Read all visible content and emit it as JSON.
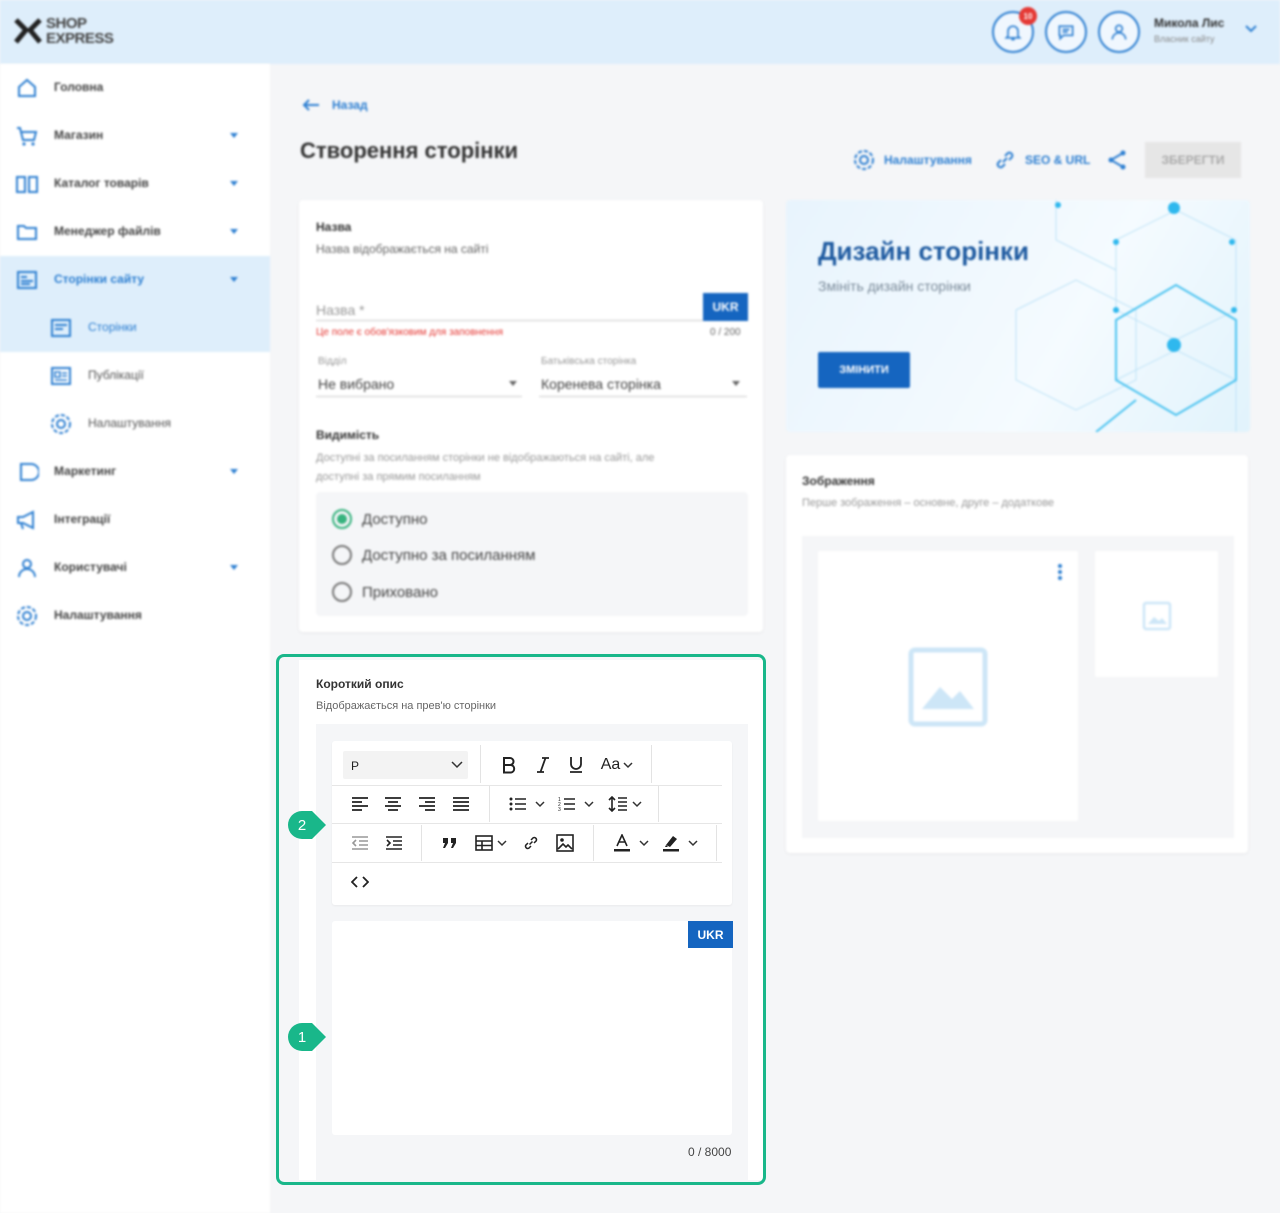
{
  "header": {
    "logo_line1": "SHOP",
    "logo_line2": "EXPRESS",
    "notif_count": "10",
    "user_name": "Микола Лис",
    "user_role": "Власник сайту"
  },
  "sidebar": {
    "items": [
      {
        "label": "Головна"
      },
      {
        "label": "Магазин"
      },
      {
        "label": "Каталог товарів"
      },
      {
        "label": "Менеджер файлів"
      },
      {
        "label": "Сторінки сайту"
      },
      {
        "label": "Маркетинг"
      },
      {
        "label": "Інтеграції"
      },
      {
        "label": "Користувачі"
      },
      {
        "label": "Налаштування"
      }
    ],
    "sub": [
      {
        "label": "Сторінки"
      },
      {
        "label": "Публікації"
      },
      {
        "label": "Налаштування"
      }
    ]
  },
  "main": {
    "back": "Назад",
    "title": "Створення сторінки",
    "actions": {
      "settings": "Налаштування",
      "seo": "SEO & URL",
      "save": "ЗБЕРЕГТИ"
    }
  },
  "name_card": {
    "title": "Назва",
    "desc": "Назва відображається на сайті",
    "field_placeholder": "Назва *",
    "lang": "UKR",
    "error": "Це поле є обов'язковим для заповнення",
    "counter": "0 / 200",
    "section_label": "Відділ",
    "section_value": "Не вибрано",
    "parent_label": "Батьківська сторінка",
    "parent_value": "Коренева сторінка",
    "visibility_title": "Видимість",
    "visibility_desc_1": "Доступні за посиланням сторінки не відображаються на сайті, але",
    "visibility_desc_2": "доступні за прямим посиланням",
    "options": [
      "Доступно",
      "Доступно за посиланням",
      "Приховано"
    ]
  },
  "design": {
    "title": "Дизайн сторінки",
    "subtitle": "Змініть дизайн сторінки",
    "button": "ЗМІНИТИ"
  },
  "images": {
    "title": "Зображення",
    "desc": "Перше зображення – основне, друге – додаткове"
  },
  "short_desc": {
    "title": "Короткий опис",
    "desc": "Відображається на прев'ю сторінки",
    "format": "P",
    "font_btn": "Aa",
    "lang": "UKR",
    "counter": "0 / 8000",
    "step1": "1",
    "step2": "2"
  },
  "colors": {
    "accent": "#2d7fd1",
    "primary_button": "#1565c0",
    "focus": "#19b78a",
    "error": "#e53935",
    "radio_on": "#36b37e"
  }
}
